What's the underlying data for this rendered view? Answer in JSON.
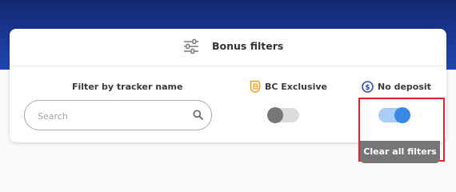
{
  "colors": {
    "header_band": "#1b3a9a",
    "card_background": "#ffffff",
    "toggle_off_track": "#dcdcdc",
    "toggle_off_knob": "#777777",
    "toggle_on_track": "#a8cdf6",
    "toggle_on_knob": "#3a87e6",
    "highlight_border": "#e2222b",
    "bc_icon": "#e6a11c",
    "no_deposit_icon": "#2f4db0",
    "clear_button": "#767676"
  },
  "card": {
    "title": "Bonus filters",
    "icon": "sliders-icon"
  },
  "tracker_filter": {
    "label": "Filter by tracker name",
    "search_placeholder": "Search",
    "search_value": "",
    "icon": "search-icon"
  },
  "toggles": [
    {
      "label": "BC Exclusive",
      "icon": "bc-badge-icon",
      "on": false
    },
    {
      "label": "No deposit",
      "icon": "dollar-coin-icon",
      "on": true
    }
  ],
  "clear_button": {
    "label": "Clear all filters"
  }
}
